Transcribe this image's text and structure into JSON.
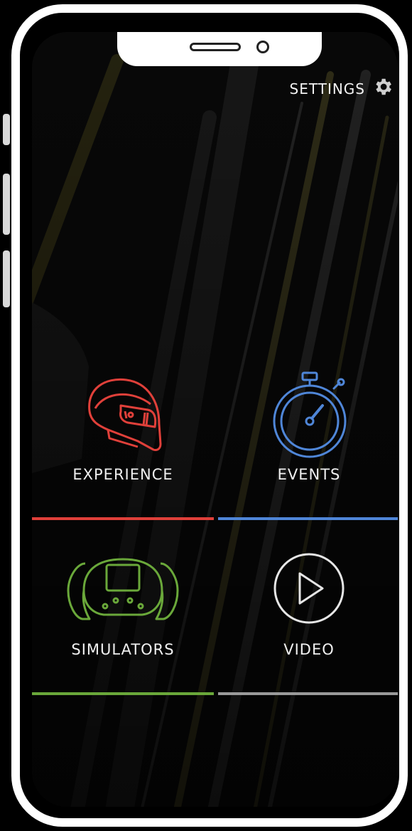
{
  "header": {
    "settings_label": "SETTINGS",
    "settings_icon": "gear-icon"
  },
  "tiles": [
    {
      "label": "EXPERIENCE",
      "icon": "helmet-icon",
      "color": "#e0403a"
    },
    {
      "label": "EVENTS",
      "icon": "stopwatch-icon",
      "color": "#4f86d8"
    },
    {
      "label": "SIMULATORS",
      "icon": "steering-wheel-icon",
      "color": "#6aa83a"
    },
    {
      "label": "VIDEO",
      "icon": "play-icon",
      "color": "#9a9a9a"
    }
  ]
}
